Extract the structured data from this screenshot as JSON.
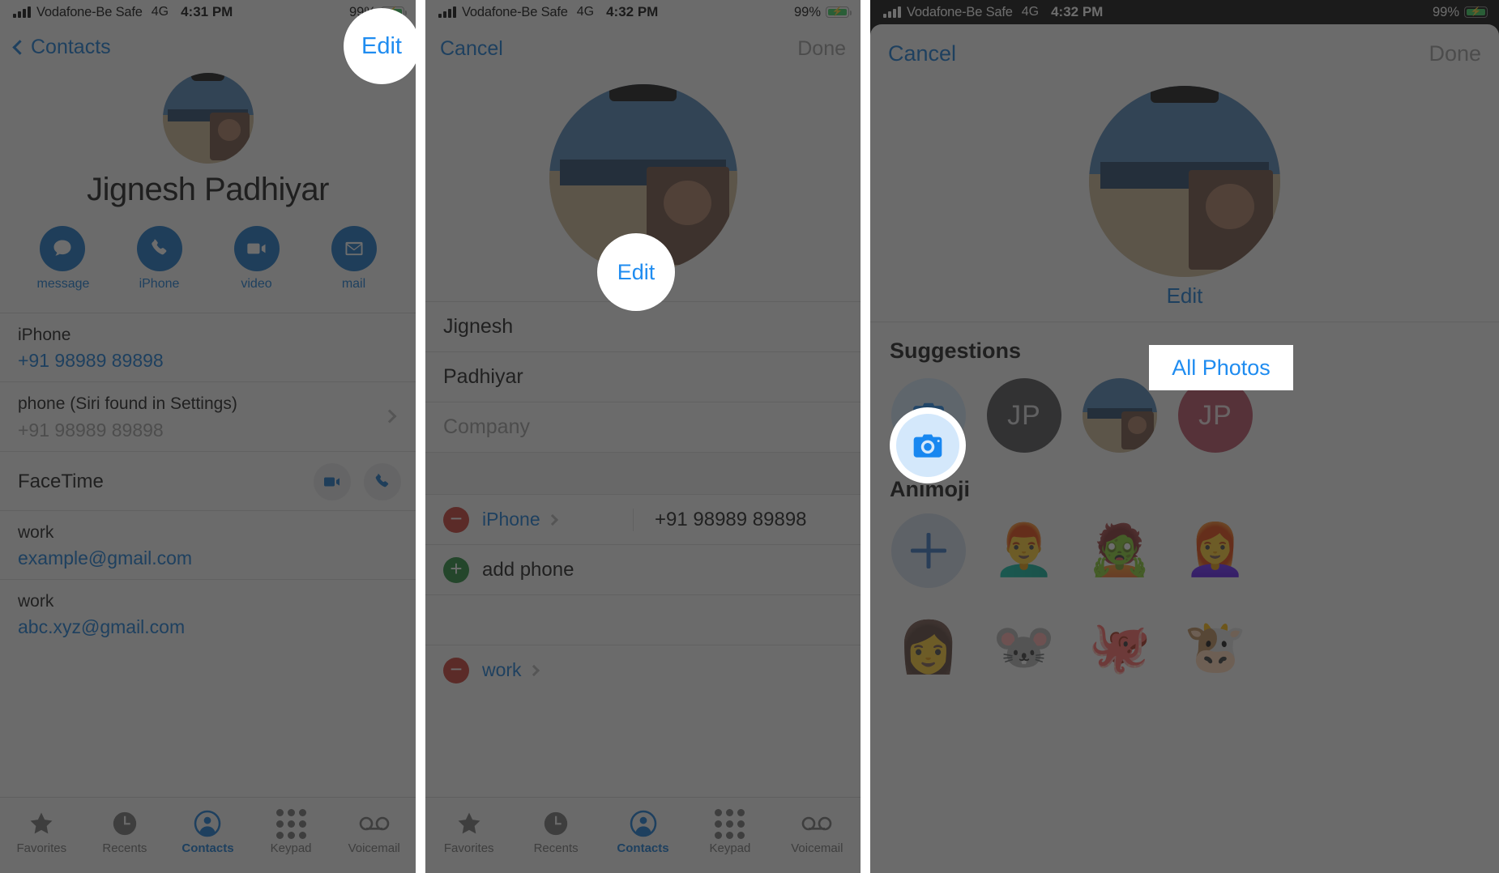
{
  "status_bar": {
    "carrier": "Vodafone-Be Safe",
    "network": "4G",
    "time_p1": "4:31 PM",
    "time_p2": "4:32 PM",
    "time_p3": "4:32 PM",
    "battery_pct": "99%",
    "battery_color": "#2fd158",
    "signal_icon": "signal-bars-icon",
    "battery_icon": "battery-charging-icon"
  },
  "accent": {
    "blue": "#0b74d4",
    "highlight_blue": "#1f8cf0",
    "red": "#c7342b",
    "green": "#1e8533"
  },
  "panel1": {
    "nav": {
      "back_label": "Contacts",
      "right_label": "Edit",
      "back_icon": "chevron-left-icon"
    },
    "contact_name": "Jignesh Padhiyar",
    "avatar_icon": "contact-photo",
    "actions": [
      {
        "label": "message",
        "icon": "message-bubble-icon"
      },
      {
        "label": "iPhone",
        "icon": "phone-handset-icon"
      },
      {
        "label": "video",
        "icon": "video-camera-icon"
      },
      {
        "label": "mail",
        "icon": "envelope-icon"
      }
    ],
    "rows": [
      {
        "key": "iPhone",
        "value": "+91 98989 89898",
        "value_style": "link",
        "chevron": false
      },
      {
        "key": "phone (Siri found in Settings)",
        "value": "+91 98989 89898",
        "value_style": "grey",
        "chevron": true
      },
      {
        "key": "FaceTime",
        "value": "",
        "value_style": "buttons",
        "chevron": false
      },
      {
        "key": "work",
        "value": "example@gmail.com",
        "value_style": "link",
        "chevron": false
      },
      {
        "key": "work",
        "value": "abc.xyz@gmail.com",
        "value_style": "link",
        "chevron": false
      }
    ],
    "facetime_buttons": [
      {
        "icon": "video-camera-icon"
      },
      {
        "icon": "phone-handset-icon"
      }
    ]
  },
  "panel2": {
    "nav": {
      "left_label": "Cancel",
      "right_label": "Done"
    },
    "avatar_edit_label": "Edit",
    "fields": [
      {
        "value": "Jignesh",
        "placeholder": false
      },
      {
        "value": "Padhiyar",
        "placeholder": false
      },
      {
        "value": "Company",
        "placeholder": true
      }
    ],
    "phone_rows": [
      {
        "action_icon": "minus-circle-icon",
        "label": "iPhone",
        "value": "+91 98989 89898",
        "chevron_icon": "chevron-right-icon"
      }
    ],
    "add_phone": {
      "action_icon": "plus-circle-icon",
      "label": "add phone"
    },
    "email_rows": [
      {
        "action_icon": "minus-circle-icon",
        "label": "work"
      }
    ]
  },
  "panel3": {
    "nav": {
      "left_label": "Cancel",
      "right_label": "Done"
    },
    "avatar_edit_label": "Edit",
    "sections": [
      {
        "title": "Suggestions"
      },
      {
        "title": "Animoji"
      }
    ],
    "all_photos_button": "All Photos",
    "suggestions": [
      {
        "type": "camera",
        "icon": "camera-icon",
        "label": ""
      },
      {
        "type": "initials",
        "label": "JP",
        "color": "#4a4a4d"
      },
      {
        "type": "photo",
        "label": ""
      },
      {
        "type": "initials",
        "label": "JP",
        "color": "#b94a5e"
      }
    ],
    "animoji_row1": [
      {
        "type": "add",
        "icon": "plus-icon"
      },
      {
        "type": "memoji",
        "glyph": "👨‍🦰"
      },
      {
        "type": "memoji",
        "glyph": "🧟"
      },
      {
        "type": "memoji",
        "glyph": "👩‍🦰"
      }
    ],
    "animoji_row2": [
      {
        "type": "memoji",
        "glyph": "👩"
      },
      {
        "type": "memoji",
        "glyph": "🐭"
      },
      {
        "type": "memoji",
        "glyph": "🐙"
      },
      {
        "type": "memoji",
        "glyph": "🐮"
      }
    ]
  },
  "tabbar": {
    "tabs": [
      {
        "label": "Favorites",
        "icon": "star-icon",
        "active": false
      },
      {
        "label": "Recents",
        "icon": "clock-icon",
        "active": false
      },
      {
        "label": "Contacts",
        "icon": "person-circle-icon",
        "active": true
      },
      {
        "label": "Keypad",
        "icon": "keypad-dots-icon",
        "active": false
      },
      {
        "label": "Voicemail",
        "icon": "voicemail-icon",
        "active": false
      }
    ]
  }
}
